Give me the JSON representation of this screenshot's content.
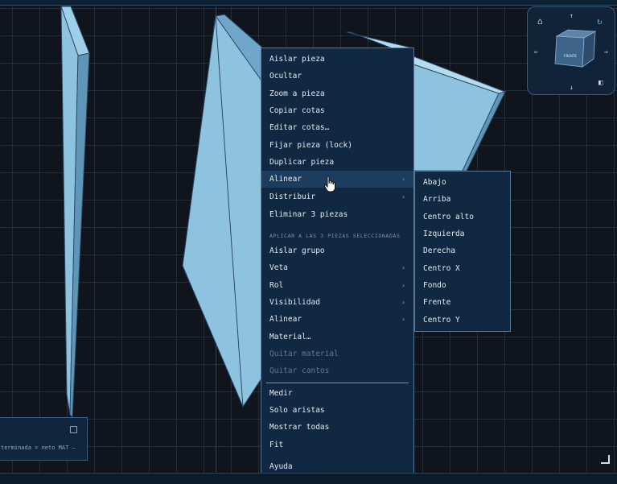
{
  "context_menu": {
    "items": [
      {
        "label": "Aislar pieza"
      },
      {
        "label": "Ocultar"
      },
      {
        "label": "Zoom a pieza"
      },
      {
        "label": "Copiar cotas"
      },
      {
        "label": "Editar cotas…"
      },
      {
        "label": "Fijar pieza (lock)"
      },
      {
        "label": "Duplicar pieza"
      },
      {
        "label": "Alinear",
        "has_submenu": true
      },
      {
        "label": "Distribuir",
        "has_submenu": true
      },
      {
        "label": "Eliminar 3 piezas"
      }
    ],
    "section_header": "APLICAR A LAS 3 PIEZAS SELECCIONADAS",
    "group_items": [
      {
        "label": "Aislar grupo"
      },
      {
        "label": "Veta",
        "has_submenu": true
      },
      {
        "label": "Rol",
        "has_submenu": true
      },
      {
        "label": "Visibilidad",
        "has_submenu": true
      },
      {
        "label": "Alinear",
        "has_submenu": true
      },
      {
        "label": "Material…"
      },
      {
        "label": "Quitar material",
        "disabled": true
      },
      {
        "label": "Quitar cantos",
        "disabled": true
      }
    ],
    "bottom_items": [
      {
        "label": "Medir"
      },
      {
        "label": "Solo aristas"
      },
      {
        "label": "Mostrar todas"
      },
      {
        "label": "Fit"
      },
      {
        "label": "Ayuda"
      }
    ],
    "submenu_arrow": "›"
  },
  "submenu": {
    "items": [
      "Abajo",
      "Arriba",
      "Centro alto",
      "Izquierda",
      "Derecha",
      "Centro X",
      "Fondo",
      "Frente",
      "Centro Y"
    ]
  },
  "info_panel": {
    "text": "terminada = neto   MAT —"
  },
  "view_cube": {
    "face_label": "FRENTE",
    "icons": [
      "home-icon",
      "refresh-icon",
      "arrow-up-icon",
      "arrow-down-icon",
      "arrow-left-icon",
      "arrow-right-icon",
      "perspective-icon"
    ]
  },
  "colors": {
    "background": "#10151d",
    "piece_fill": "#8ec3e0",
    "piece_shadow": "#5f96b8",
    "menu_bg": "#102841",
    "menu_hover": "#1c3d5e"
  }
}
